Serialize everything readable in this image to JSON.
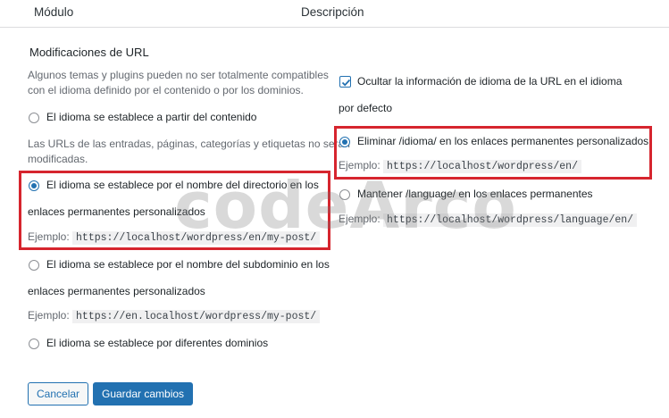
{
  "header": {
    "col_module": "Módulo",
    "col_description": "Descripción"
  },
  "url_mods": {
    "title": "Modificaciones de URL",
    "description_line1": "Algunos temas y plugins pueden no ser totalmente compatibles",
    "description_line2": "con el idioma definido por el contenido o por los dominios.",
    "option_content": "El idioma se establece a partir del contenido",
    "content_note_line1": "Las URLs de las entradas, páginas, categorías y etiquetas no serán",
    "content_note_line2": "modificadas.",
    "option_directory_line1": "El idioma se establece por el nombre del directorio en los",
    "option_directory_line2": "enlaces permanentes personalizados",
    "directory_example_label": "Ejemplo:",
    "directory_example_code": "https://localhost/wordpress/en/my-post/",
    "option_subdomain_line1": "El idioma se establece por el nombre del subdominio en los",
    "option_subdomain_line2": "enlaces permanentes personalizados",
    "subdomain_example_label": "Ejemplo:",
    "subdomain_example_code": "https://en.localhost/wordpress/my-post/",
    "option_domains": "El idioma se establece por diferentes dominios",
    "selected_option": "directory"
  },
  "right_column": {
    "hide_default_line1": "Ocultar la información de idioma de la URL en el idioma",
    "hide_default_line2": "por defecto",
    "hide_default_checked": true,
    "remove_language": "Eliminar /idioma/ en los enlaces permanentes personalizados",
    "remove_example_label": "Ejemplo:",
    "remove_example_code": "https://localhost/wordpress/en/",
    "keep_language": "Mantener /language/ en los enlaces permanentes",
    "keep_example_label": "Ejemplo:",
    "keep_example_code": "https://localhost/wordpress/language/en/",
    "selected_option": "remove"
  },
  "buttons": {
    "cancel": "Cancelar",
    "save": "Guardar cambios"
  },
  "watermark": "codeArco",
  "colors": {
    "accent": "#2271b1",
    "highlight": "#d6252e"
  }
}
